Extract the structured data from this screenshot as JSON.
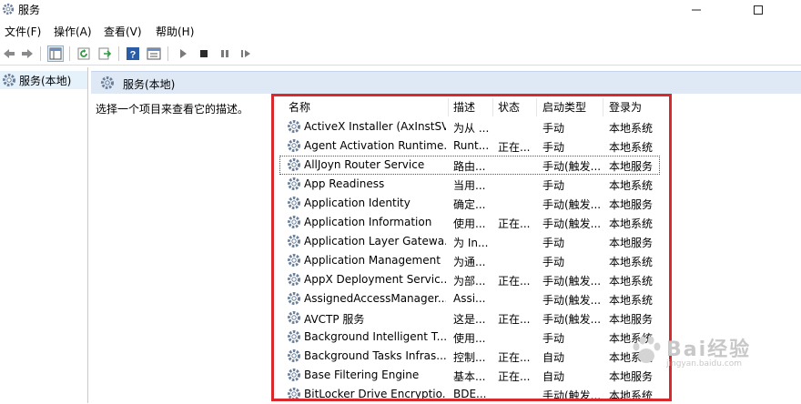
{
  "window": {
    "title": "服务"
  },
  "menu": [
    "文件(F)",
    "操作(A)",
    "查看(V)",
    "帮助(H)"
  ],
  "left": {
    "item": "服务(本地)"
  },
  "main": {
    "header": "服务(本地)",
    "description": "选择一个项目来查看它的描述。"
  },
  "columns": [
    "名称",
    "描述",
    "状态",
    "启动类型",
    "登录为"
  ],
  "rows": [
    {
      "name": "ActiveX Installer (AxInstSV)",
      "desc": "为从 ...",
      "status": "",
      "startup": "手动",
      "logon": "本地系统"
    },
    {
      "name": "Agent Activation Runtime...",
      "desc": "Runt...",
      "status": "正在...",
      "startup": "手动",
      "logon": "本地系统"
    },
    {
      "name": "AllJoyn Router Service",
      "desc": "路由...",
      "status": "",
      "startup": "手动(触发...",
      "logon": "本地服务"
    },
    {
      "name": "App Readiness",
      "desc": "当用...",
      "status": "",
      "startup": "手动",
      "logon": "本地系统"
    },
    {
      "name": "Application Identity",
      "desc": "确定...",
      "status": "",
      "startup": "手动(触发...",
      "logon": "本地服务"
    },
    {
      "name": "Application Information",
      "desc": "使用...",
      "status": "正在...",
      "startup": "手动(触发...",
      "logon": "本地系统"
    },
    {
      "name": "Application Layer Gatewa...",
      "desc": "为 In...",
      "status": "",
      "startup": "手动",
      "logon": "本地服务"
    },
    {
      "name": "Application Management",
      "desc": "为通...",
      "status": "",
      "startup": "手动",
      "logon": "本地系统"
    },
    {
      "name": "AppX Deployment Servic...",
      "desc": "为部...",
      "status": "正在...",
      "startup": "手动(触发...",
      "logon": "本地系统"
    },
    {
      "name": "AssignedAccessManager...",
      "desc": "Assi...",
      "status": "",
      "startup": "手动(触发...",
      "logon": "本地系统"
    },
    {
      "name": "AVCTP 服务",
      "desc": "这是...",
      "status": "正在...",
      "startup": "手动(触发...",
      "logon": "本地服务"
    },
    {
      "name": "Background Intelligent T...",
      "desc": "使用...",
      "status": "",
      "startup": "手动",
      "logon": "本地系统"
    },
    {
      "name": "Background Tasks Infras...",
      "desc": "控制...",
      "status": "正在...",
      "startup": "自动",
      "logon": "本地系统"
    },
    {
      "name": "Base Filtering Engine",
      "desc": "基本...",
      "status": "正在...",
      "startup": "自动",
      "logon": "本地服务"
    },
    {
      "name": "BitLocker Drive Encryptio...",
      "desc": "BDE...",
      "status": "",
      "startup": "手动(触发...",
      "logon": "本地系统"
    }
  ],
  "watermark": {
    "big": "Bai经验",
    "small": "jingyan.baidu.com"
  },
  "colors": {
    "highlight": "#d8292f",
    "header_bg": "#dfe8f5"
  }
}
